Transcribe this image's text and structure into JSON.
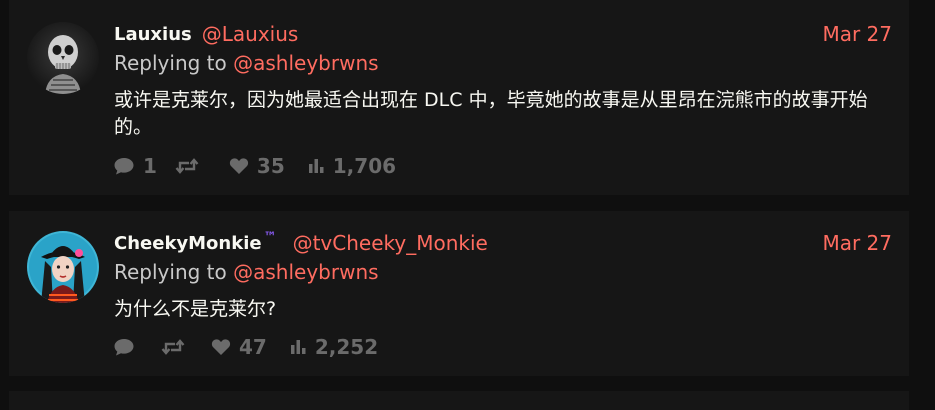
{
  "tweets": [
    {
      "fullname": "Lauxius",
      "verified_mark": "",
      "username": "@Lauxius",
      "date": "Mar 27",
      "replying_prefix": "Replying to ",
      "replying_to": "@ashleybrwns",
      "content": "或许是克莱尔，因为她最适合出现在 DLC 中，毕竟她的故事是从里昂在浣熊市的故事开始的。",
      "stats": {
        "replies": "1",
        "retweets": "",
        "likes": "35",
        "views": "1,706"
      },
      "avatar": {
        "icon": "skull-avatar",
        "color": "#2a2a2a"
      }
    },
    {
      "fullname": "CheekyMonkie",
      "verified_mark": "™",
      "username": "@tvCheeky_Monkie",
      "date": "Mar 27",
      "replying_prefix": "Replying to ",
      "replying_to": "@ashleybrwns",
      "content": "为什么不是克莱尔?",
      "stats": {
        "replies": "",
        "retweets": "",
        "likes": "47",
        "views": "2,252"
      },
      "avatar": {
        "icon": "witch-avatar",
        "color": "#3fb6d6"
      }
    }
  ],
  "colors": {
    "accent": "#ff6c60",
    "background": "#0f0f0f",
    "card": "#161616",
    "muted": "#6b6b6b",
    "verified": "#8a5cf6"
  },
  "icons": {
    "reply": "comment-bubble-icon",
    "retweet": "retweet-icon",
    "like": "heart-icon",
    "views": "bar-chart-icon"
  }
}
